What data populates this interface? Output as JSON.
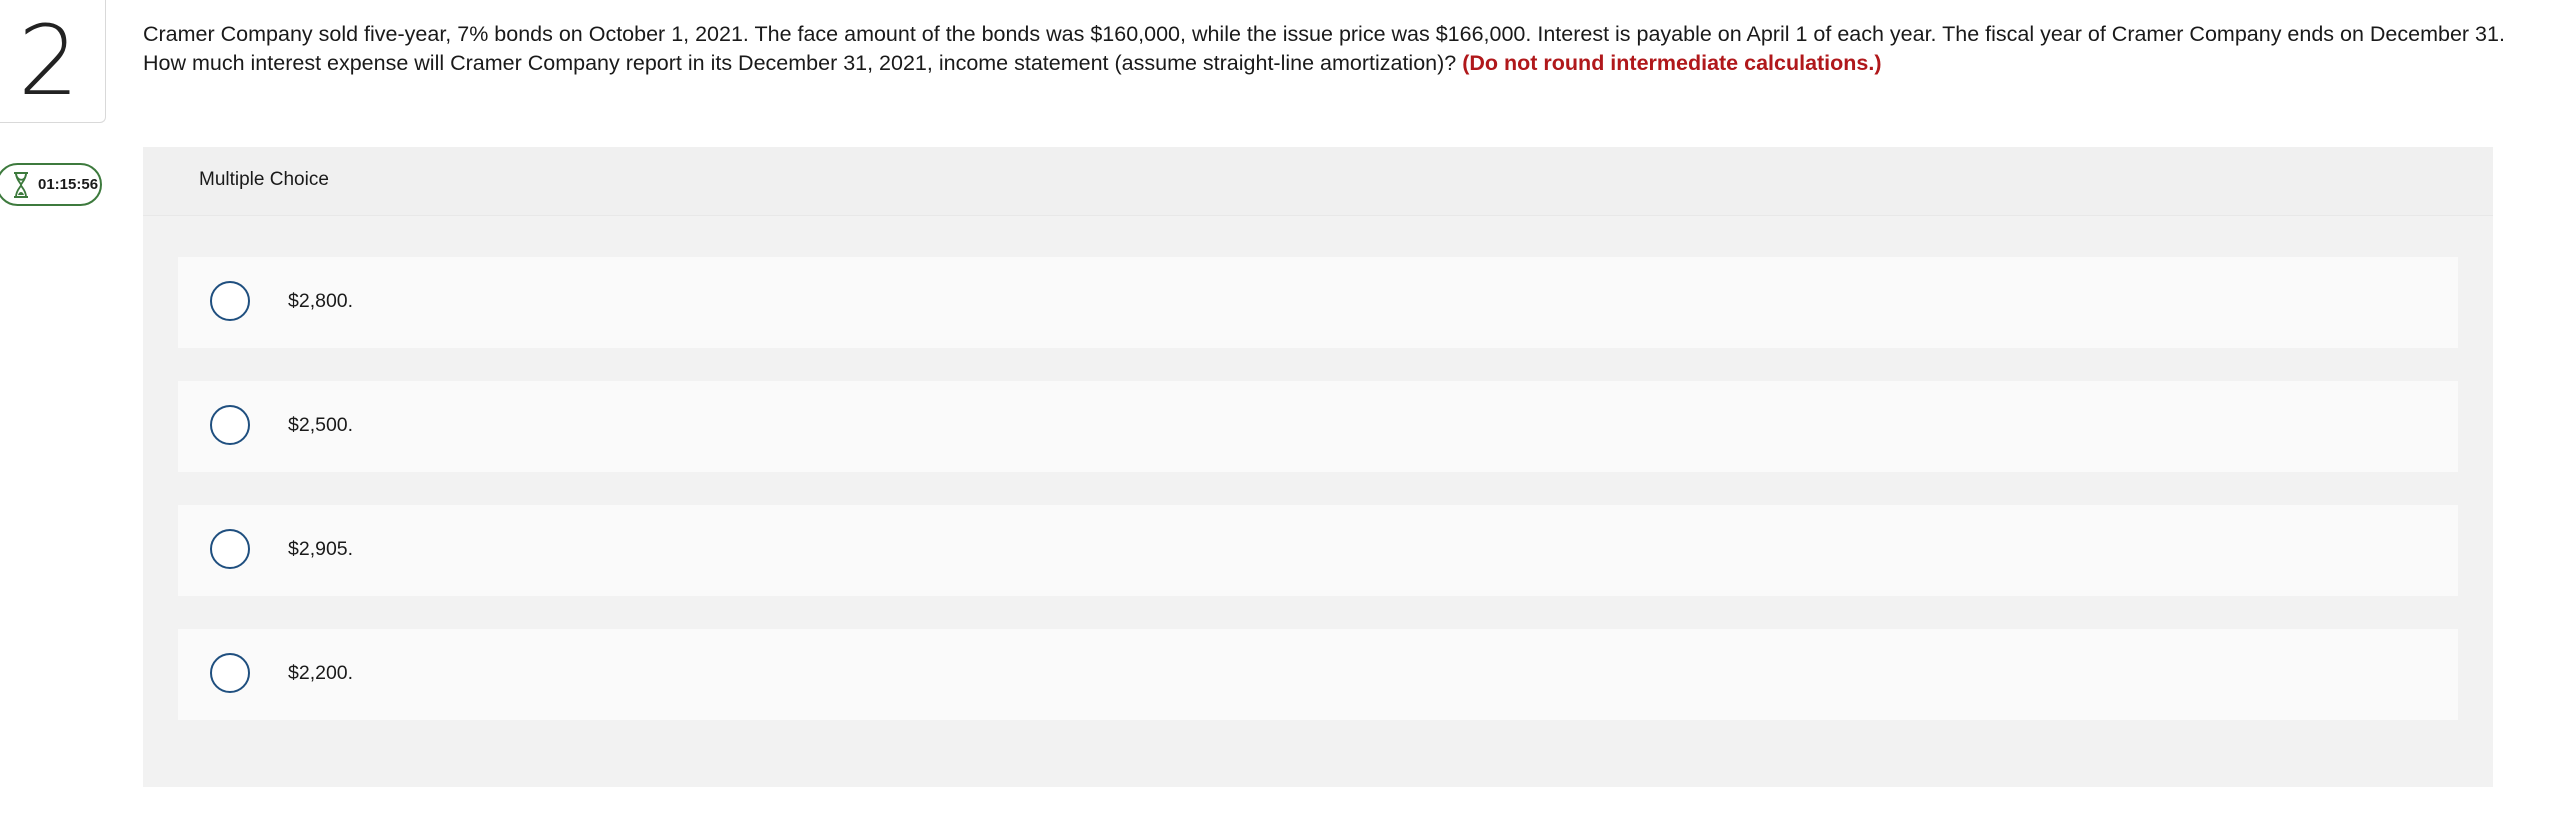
{
  "question": {
    "number": "2",
    "text": "Cramer Company sold five-year, 7% bonds on October 1, 2021. The face amount of the bonds was $160,000, while the issue price was $166,000. Interest is payable on April 1 of each year. The fiscal year of Cramer Company ends on December 31. How much interest expense will Cramer Company report in its December 31, 2021, income statement (assume straight-line amortization)?",
    "note": "(Do not round intermediate calculations.)"
  },
  "timer": {
    "value": "01:15:56",
    "icon": "hourglass-icon"
  },
  "multiple_choice": {
    "title": "Multiple Choice",
    "options": [
      {
        "label": "$2,800."
      },
      {
        "label": "$2,500."
      },
      {
        "label": "$2,905."
      },
      {
        "label": "$2,200."
      }
    ]
  },
  "colors": {
    "note_red": "#b0181b",
    "radio_border": "#1f4f7f",
    "timer_border": "#3d7a3d",
    "panel_bg": "#f2f2f2",
    "choice_bg": "#fafafa"
  }
}
